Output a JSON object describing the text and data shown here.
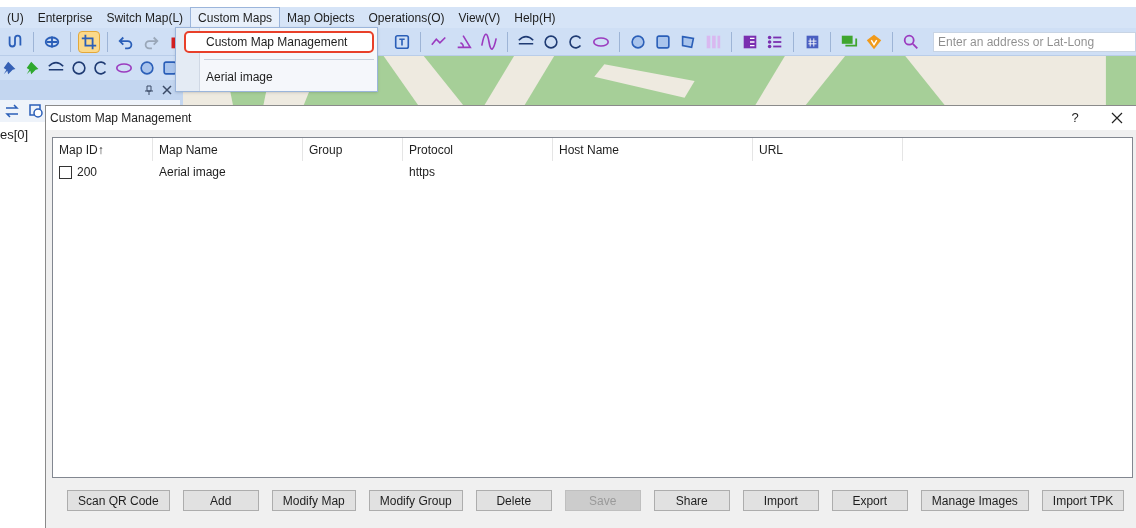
{
  "menubar": [
    {
      "label": "(U)",
      "selected": false
    },
    {
      "label": "Enterprise",
      "selected": false
    },
    {
      "label": "Switch Map(L)",
      "selected": false
    },
    {
      "label": "Custom Maps",
      "selected": true
    },
    {
      "label": "Map Objects",
      "selected": false
    },
    {
      "label": "Operations(O)",
      "selected": false
    },
    {
      "label": "View(V)",
      "selected": false
    },
    {
      "label": "Help(H)",
      "selected": false
    }
  ],
  "toolbar_top": [
    {
      "kind": "route",
      "selected": false
    },
    {
      "kind": "sep"
    },
    {
      "kind": "globe",
      "selected": false
    },
    {
      "kind": "sep"
    },
    {
      "kind": "crop",
      "selected": true
    },
    {
      "kind": "sep"
    },
    {
      "kind": "undo",
      "selected": false
    },
    {
      "kind": "redo",
      "selected": false
    },
    {
      "kind": "trash",
      "selected": false
    }
  ],
  "toolbar_right": [
    {
      "kind": "textbox",
      "selected": false
    },
    {
      "kind": "sep"
    },
    {
      "kind": "polyline",
      "selected": false
    },
    {
      "kind": "angle",
      "selected": false
    },
    {
      "kind": "wave",
      "selected": false
    },
    {
      "kind": "sep"
    },
    {
      "kind": "arc",
      "selected": false
    },
    {
      "kind": "circle",
      "selected": false
    },
    {
      "kind": "partial-circle",
      "selected": false
    },
    {
      "kind": "ellipse",
      "selected": false
    },
    {
      "kind": "sep"
    },
    {
      "kind": "hatched-circle",
      "selected": false
    },
    {
      "kind": "hatched-square",
      "selected": false
    },
    {
      "kind": "polygon",
      "selected": false
    },
    {
      "kind": "bars",
      "selected": false
    },
    {
      "kind": "sep"
    },
    {
      "kind": "panel",
      "selected": false
    },
    {
      "kind": "list",
      "selected": false
    },
    {
      "kind": "sep"
    },
    {
      "kind": "building",
      "selected": false
    },
    {
      "kind": "sep"
    },
    {
      "kind": "chat",
      "selected": false
    },
    {
      "kind": "badge",
      "selected": false
    },
    {
      "kind": "sep"
    },
    {
      "kind": "search",
      "selected": false
    }
  ],
  "address": {
    "placeholder": "Enter an address or Lat-Long"
  },
  "toolbar_second": [
    {
      "kind": "pin-blue",
      "selected": false
    },
    {
      "kind": "pin-green",
      "selected": false
    },
    {
      "kind": "arc",
      "selected": false
    },
    {
      "kind": "circle",
      "selected": false
    },
    {
      "kind": "partial-circle",
      "selected": false
    },
    {
      "kind": "ellipse",
      "selected": false
    },
    {
      "kind": "hatched-circle",
      "selected": false
    },
    {
      "kind": "hatched-square",
      "selected": false
    }
  ],
  "side_panel": {
    "tree_text": "es[0]"
  },
  "dropdown": {
    "items": [
      {
        "label": "Custom Map Management",
        "highlighted": true
      },
      {
        "label": "Aerial image",
        "highlighted": false
      }
    ]
  },
  "dialog": {
    "title": "Custom Map Management",
    "help": "?",
    "table": {
      "columns": [
        "Map ID↑",
        "Map Name",
        "Group",
        "Protocol",
        "Host Name",
        "URL"
      ],
      "rows": [
        {
          "checked": false,
          "cells": [
            "200",
            "Aerial image",
            "",
            "https",
            "",
            ""
          ]
        }
      ]
    },
    "buttons": [
      {
        "label": "Scan QR Code",
        "disabled": false
      },
      {
        "label": "Add",
        "disabled": false
      },
      {
        "label": "Modify Map",
        "disabled": false
      },
      {
        "label": "Modify Group",
        "disabled": false
      },
      {
        "label": "Delete",
        "disabled": false
      },
      {
        "label": "Save",
        "disabled": true
      },
      {
        "label": "Share",
        "disabled": false
      },
      {
        "label": "Import",
        "disabled": false
      },
      {
        "label": "Export",
        "disabled": false
      },
      {
        "label": "Manage Images",
        "disabled": false
      },
      {
        "label": "Import TPK",
        "disabled": false
      }
    ]
  }
}
